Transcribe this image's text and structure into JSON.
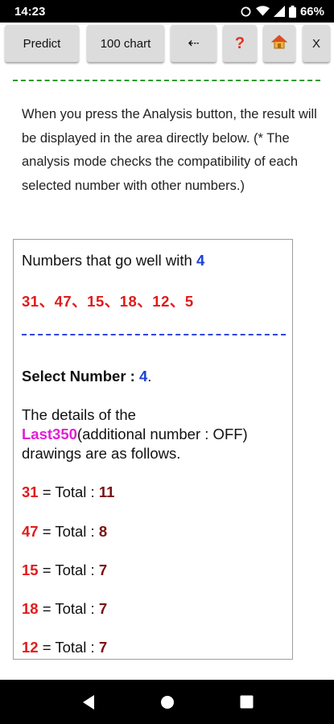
{
  "status_bar": {
    "time": "14:23",
    "battery": "66%",
    "icons": [
      "sync-icon",
      "wifi-icon",
      "signal-icon",
      "battery-icon"
    ]
  },
  "toolbar": {
    "predict_label": "Predict",
    "chart_label": "100 chart",
    "back_label": "⇠",
    "help_label": "?",
    "home_label": "🏠",
    "close_label": "X"
  },
  "intro_text": "When you press the Analysis button, the result will be displayed in the area directly below. (* The analysis mode checks the compatibility of each selected number with other numbers.)",
  "result": {
    "go_well_prefix": "Numbers that go well with ",
    "selected_number": "4",
    "compatible_numbers": "31、47、15、18、12、5",
    "select_label": "Select Number : ",
    "select_number": "4",
    "select_suffix": ".",
    "details_line1": "The details of the",
    "last_label": "Last350",
    "details_line2_rest": "(additional number : OFF)",
    "details_line3": "drawings are as follows.",
    "totals": [
      {
        "number": "31",
        "separator": " = Total : ",
        "total": "11"
      },
      {
        "number": "47",
        "separator": " = Total : ",
        "total": "8"
      },
      {
        "number": "15",
        "separator": " = Total : ",
        "total": "7"
      },
      {
        "number": "18",
        "separator": " = Total : ",
        "total": "7"
      },
      {
        "number": "12",
        "separator": " = Total : ",
        "total": "7"
      }
    ]
  },
  "colors": {
    "green_divider": "#2e9b2e",
    "blue_divider": "#3047e0",
    "number_red": "#e01b1b",
    "highlight_pink": "#e020d8",
    "total_dark_red": "#7a1010",
    "selected_blue": "#1a3fd6"
  }
}
